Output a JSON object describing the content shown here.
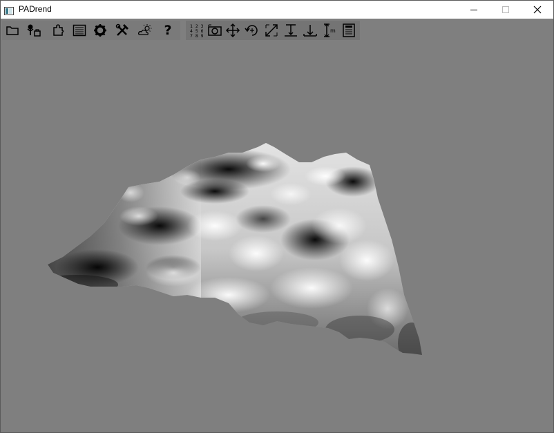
{
  "window": {
    "title": "PADrend",
    "controls": [
      "minimize",
      "maximize",
      "close"
    ]
  },
  "toolbar": {
    "tools": [
      {
        "name": "open-file",
        "icon": "folder-icon"
      },
      {
        "name": "scene-tree",
        "icon": "tree-icon"
      },
      {
        "name": "plugins",
        "icon": "puzzle-icon"
      },
      {
        "name": "console",
        "icon": "list-icon"
      },
      {
        "name": "settings",
        "icon": "gear-icon"
      },
      {
        "name": "tools",
        "icon": "wrench-hammer-icon"
      },
      {
        "name": "effects",
        "icon": "weather-icon"
      },
      {
        "name": "help",
        "label": "?",
        "icon": "question-icon"
      }
    ],
    "transform_tools": [
      {
        "name": "numeric",
        "label": "123\n456\n789",
        "icon": "numpad-icon"
      },
      {
        "name": "camera-select",
        "icon": "camera-icon"
      },
      {
        "name": "translate",
        "icon": "move-icon"
      },
      {
        "name": "rotate",
        "icon": "rotate-icon"
      },
      {
        "name": "scale",
        "icon": "scale-icon"
      },
      {
        "name": "snap-floor",
        "icon": "snap-icon"
      },
      {
        "name": "anchor",
        "icon": "anchor-icon"
      },
      {
        "name": "measure",
        "label": "m",
        "icon": "measure-icon"
      },
      {
        "name": "notes",
        "icon": "notes-icon"
      }
    ]
  },
  "viewport": {
    "background": "#7f7f7f",
    "content": "3d-terrain-heightmap"
  }
}
